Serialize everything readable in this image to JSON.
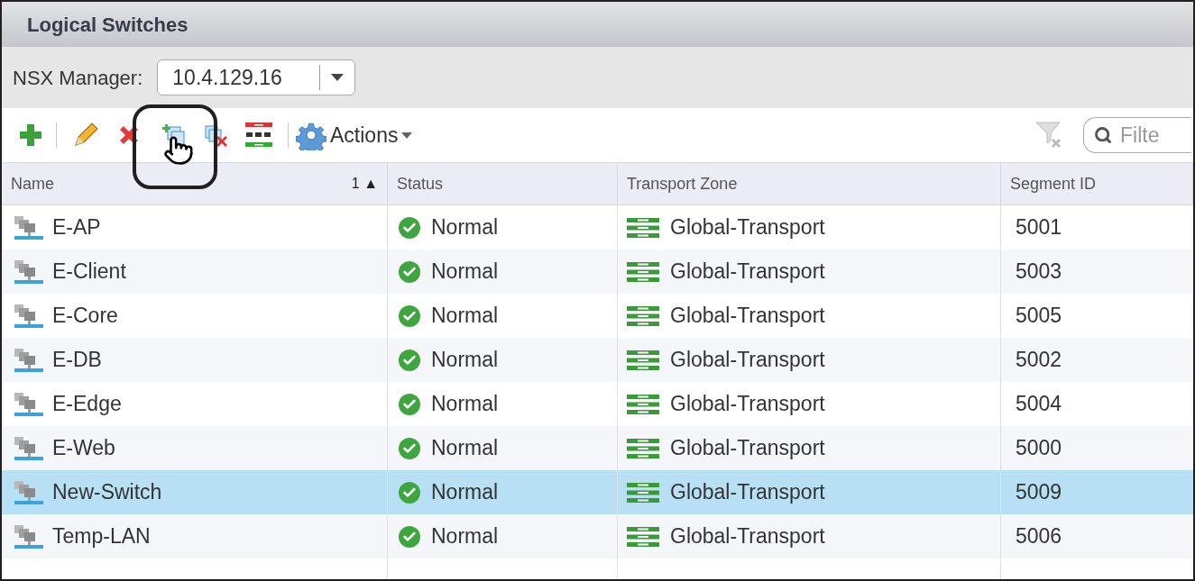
{
  "window": {
    "title": "Logical Switches"
  },
  "manager": {
    "label": "NSX Manager:",
    "value": "10.4.129.16"
  },
  "toolbar": {
    "tools": [
      {
        "kind": "add"
      },
      {
        "kind": "sep"
      },
      {
        "kind": "edit"
      },
      {
        "kind": "delete"
      },
      {
        "kind": "copy",
        "highlighted": true
      },
      {
        "kind": "remove"
      },
      {
        "kind": "columns"
      },
      {
        "kind": "sep"
      }
    ],
    "actions": "Actions",
    "filter": {
      "placeholder": "Filte"
    }
  },
  "table": {
    "columns": [
      {
        "label": "Name",
        "sort_order": "1",
        "sort_mark": "▲"
      },
      {
        "label": "Status"
      },
      {
        "label": "Transport Zone"
      },
      {
        "label": "Segment ID"
      }
    ],
    "rows": [
      {
        "name": "E-AP",
        "status": "Normal",
        "transport_zone": "Global-Transport",
        "segment_id": "5001",
        "selected": false
      },
      {
        "name": "E-Client",
        "status": "Normal",
        "transport_zone": "Global-Transport",
        "segment_id": "5003",
        "selected": false
      },
      {
        "name": "E-Core",
        "status": "Normal",
        "transport_zone": "Global-Transport",
        "segment_id": "5005",
        "selected": false
      },
      {
        "name": "E-DB",
        "status": "Normal",
        "transport_zone": "Global-Transport",
        "segment_id": "5002",
        "selected": false
      },
      {
        "name": "E-Edge",
        "status": "Normal",
        "transport_zone": "Global-Transport",
        "segment_id": "5004",
        "selected": false
      },
      {
        "name": "E-Web",
        "status": "Normal",
        "transport_zone": "Global-Transport",
        "segment_id": "5000",
        "selected": false
      },
      {
        "name": "New-Switch",
        "status": "Normal",
        "transport_zone": "Global-Transport",
        "segment_id": "5009",
        "selected": true
      },
      {
        "name": "Temp-LAN",
        "status": "Normal",
        "transport_zone": "Global-Transport",
        "segment_id": "5006",
        "selected": false
      }
    ]
  }
}
